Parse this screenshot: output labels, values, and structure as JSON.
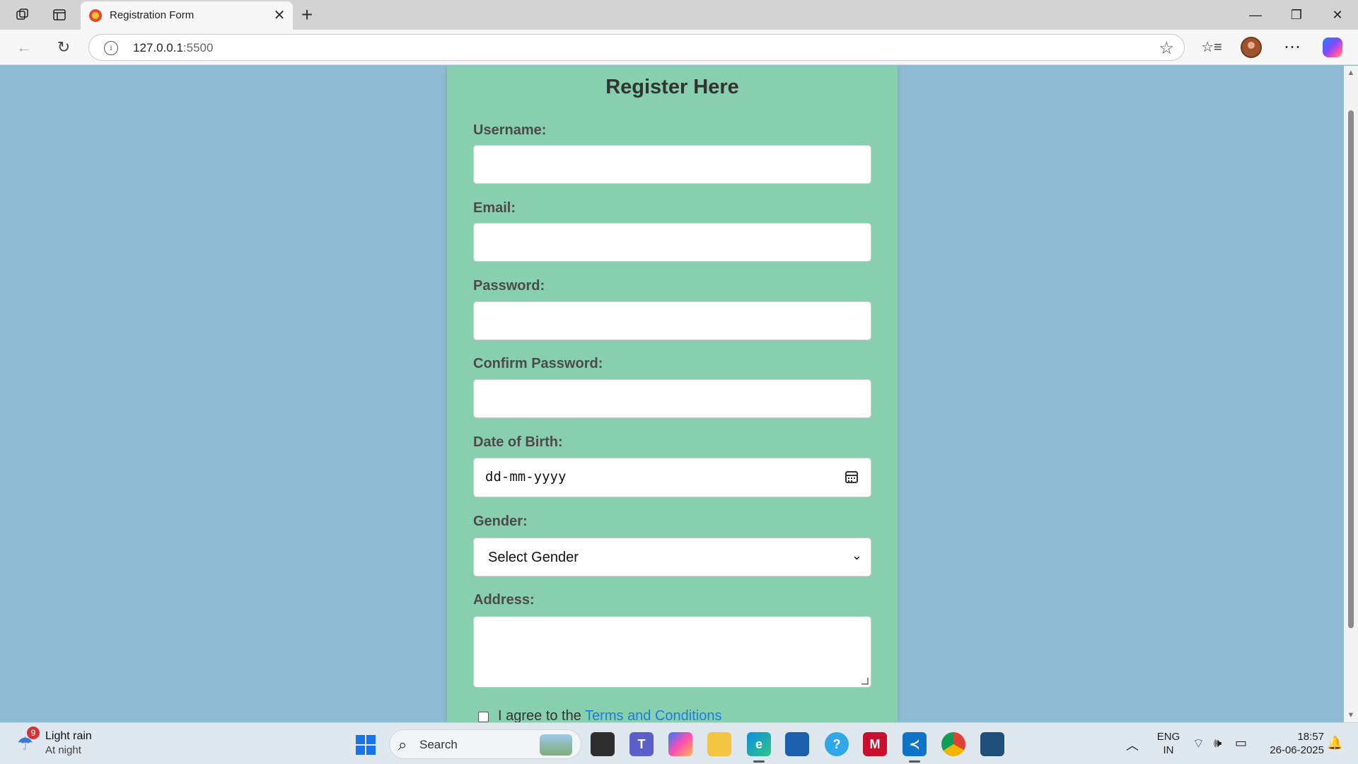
{
  "browser": {
    "tab_title": "Registration Form",
    "url_host": "127.0.0.1",
    "url_port": ":5500"
  },
  "form": {
    "heading": "Register Here",
    "username_label": "Username:",
    "email_label": "Email:",
    "password_label": "Password:",
    "confirm_password_label": "Confirm Password:",
    "dob_label": "Date of Birth:",
    "dob_placeholder": "dd-mm-yyyy",
    "gender_label": "Gender:",
    "gender_selected": "Select Gender",
    "address_label": "Address:",
    "agree_text": "I agree to the ",
    "terms_link": "Terms and Conditions"
  },
  "taskbar": {
    "weather_badge": "9",
    "weather_line1": "Light rain",
    "weather_line2": "At night",
    "search_label": "Search",
    "lang_line1": "ENG",
    "lang_line2": "IN",
    "time": "18:57",
    "date": "26-06-2025"
  },
  "colors": {
    "page_background": "#8fbbd2",
    "card_background": "#87cfae",
    "link": "#1a7ee0"
  }
}
